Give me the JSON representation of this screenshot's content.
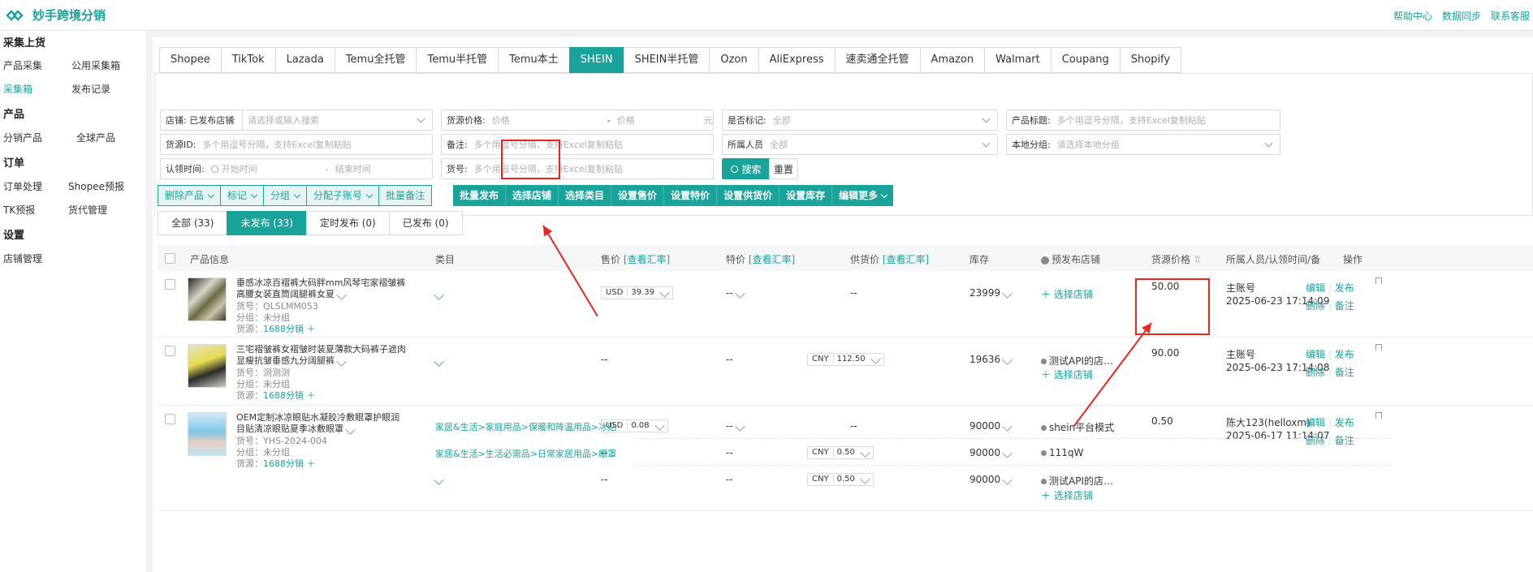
{
  "app": {
    "title": "妙手跨境分销",
    "links": [
      "帮助中心",
      "数据同步",
      "联系客服"
    ]
  },
  "sidebar": {
    "sections": [
      "采集上货",
      "产品",
      "订单",
      "设置"
    ],
    "items": [
      "产品采集",
      "公用采集箱",
      "采集箱",
      "发布记录",
      "分销产品",
      "全球产品",
      "订单处理",
      "Shopee预报",
      "TK预报",
      "货代管理",
      "店铺管理"
    ]
  },
  "tabs": [
    "Shopee",
    "TikTok",
    "Lazada",
    "Temu全托管",
    "Temu半托管",
    "Temu本土",
    "SHEIN",
    "SHEIN半托管",
    "Ozon",
    "AliExpress",
    "速卖通全托管",
    "Amazon",
    "Walmart",
    "Coupang",
    "Shopify"
  ],
  "filters": {
    "store_label": "店铺: 已发布店铺",
    "store_ph": "请选择或输入搜索",
    "price_label": "货源价格:",
    "price_min_ph": "价格",
    "price_max_ph": "价格",
    "price_unit": "元",
    "price_sep": "-",
    "mark_label": "是否标记:",
    "mark_val": "全部",
    "title_label": "产品标题:",
    "title_ph": "多个用逗号分隔，支持Excel复制粘贴",
    "srcid_label": "货源ID:",
    "srcid_ph": "多个用逗号分隔，支持Excel复制粘贴",
    "note_label": "备注:",
    "note_ph": "多个用逗号分隔，支持Excel复制粘贴",
    "owner_label": "所属人员",
    "owner_val": "全部",
    "group_label": "本地分组:",
    "group_ph": "请选择本地分组",
    "claim_label": "认领时间:",
    "claim_start": "开始时间",
    "claim_sep": "-",
    "claim_end": "结束时间",
    "sku_label": "货号:",
    "sku_ph": "多个用逗号分隔，支持Excel复制粘贴",
    "search": "搜索",
    "reset": "重置"
  },
  "toolbar1": [
    "删除产品",
    "标记",
    "分组",
    "分配子账号",
    "批量备注"
  ],
  "toolbar2": [
    "批量发布",
    "选择店铺",
    "选择类目",
    "设置售价",
    "设置特价",
    "设置供货价",
    "设置库存",
    "编辑更多"
  ],
  "status_tabs": [
    "全部 (33)",
    "未发布 (33)",
    "定时发布 (0)",
    "已发布 (0)"
  ],
  "columns": {
    "info": "产品信息",
    "category": "类目",
    "price": "售价",
    "rate": "[查看汇率]",
    "special": "特价",
    "supply": "供货价",
    "stock": "库存",
    "prestore": "预发布店铺",
    "srcprice": "货源价格",
    "owner": "所属人员/认领时间/备",
    "ops": "操作"
  },
  "rows": [
    {
      "title": "垂感冰凉百褶裤大码胖mm风琴宅家褶皱裤高腰女装直筒阔腿裤女夏",
      "sku": "货号：QLSLMM053",
      "group": "分组：未分组",
      "src": "货源：",
      "srclink": "1688分销",
      "lines": [
        {
          "cat": "",
          "price_cur": "USD",
          "price": "39.39",
          "special": "--",
          "supply": "--",
          "stock": "23999",
          "store": ""
        }
      ],
      "storebtn": "选择店铺",
      "srcprice": "50.00",
      "owner": "主账号",
      "time": "2025-06-23 17:14:09"
    },
    {
      "title": "三宅褶皱裤女褶皱时装夏薄款大码裤子遮肉显瘦抗皱垂感九分阔腿裤",
      "sku": "货号：测测测",
      "group": "分组：未分组",
      "src": "货源：",
      "srclink": "1688分销",
      "lines": [
        {
          "cat": "",
          "price": "--",
          "special": "--",
          "supply_cur": "CNY",
          "supply": "112.50",
          "stock": "19636",
          "store": "测试API的店…"
        }
      ],
      "storebtn": "选择店铺",
      "srcprice": "90.00",
      "owner": "主账号",
      "time": "2025-06-23 17:14:08"
    },
    {
      "title": "OEM定制冰凉眼贴水凝胶冷敷眼罩护眼润目贴清凉眼贴夏季冰敷眼罩",
      "sku": "货号：YHS-2024-004",
      "group": "分组：未分组",
      "src": "货源：",
      "srclink": "1688分销",
      "lines": [
        {
          "cat": "家居&生活>家庭用品>保暖和降温用品>冰贴",
          "price_cur": "USD",
          "price": "0.08",
          "special": "--",
          "supply": "--",
          "stock": "90000",
          "store": "shein平台模式"
        },
        {
          "cat": "家居&生活>生活必需品>日常家居用品>眼罩",
          "price": "--",
          "special": "--",
          "supply_cur": "CNY",
          "supply": "0.50",
          "stock": "90000",
          "store": "111qW"
        },
        {
          "cat": "",
          "price": "--",
          "special": "--",
          "supply_cur": "CNY",
          "supply": "0.50",
          "stock": "90000",
          "store": "测试API的店…"
        }
      ],
      "storebtn": "选择店铺",
      "srcprice": "0.50",
      "owner": "陈大123(helloxm)",
      "time": "2025-06-17 11:14:07"
    }
  ],
  "actions": {
    "edit": "编辑",
    "publish": "发布",
    "delete": "删除",
    "note": "备注"
  },
  "accent": "#1aa39a",
  "highlight": "#e8261b"
}
